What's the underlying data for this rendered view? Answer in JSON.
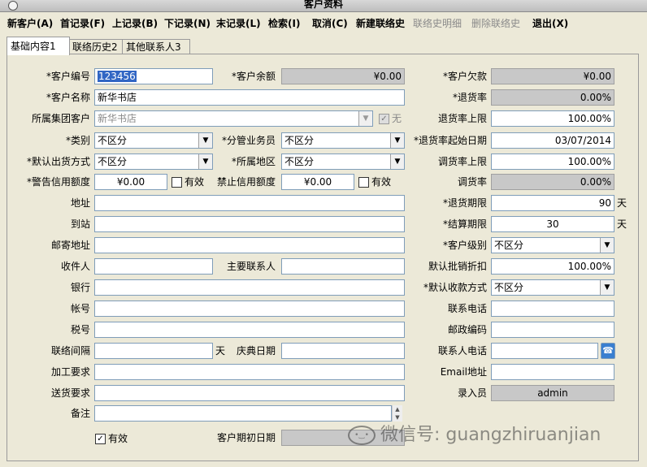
{
  "window": {
    "title": "客户资料"
  },
  "toolbar": {
    "items": [
      {
        "label": "新客户(A)",
        "enabled": true
      },
      {
        "label": "首记录(F)",
        "enabled": true
      },
      {
        "label": "上记录(B)",
        "enabled": true
      },
      {
        "label": "下记录(N)",
        "enabled": true
      },
      {
        "label": "末记录(L)",
        "enabled": true
      },
      {
        "label": "检索(I)",
        "enabled": true
      },
      {
        "label": "取消(C)",
        "enabled": true
      },
      {
        "label": "新建联络史",
        "enabled": true
      },
      {
        "label": "联络史明细",
        "enabled": false
      },
      {
        "label": "删除联络史",
        "enabled": false
      },
      {
        "label": "退出(X)",
        "enabled": true
      }
    ]
  },
  "tabs": [
    {
      "label": "基础内容1",
      "active": true
    },
    {
      "label": "联络历史2",
      "active": false
    },
    {
      "label": "其他联系人3",
      "active": false
    }
  ],
  "form": {
    "customer_id": {
      "label": "*客户编号",
      "value": "123456"
    },
    "balance": {
      "label": "*客户余额",
      "value": "¥0.00"
    },
    "debt": {
      "label": "*客户欠款",
      "value": "¥0.00"
    },
    "customer_name": {
      "label": "*客户名称",
      "value": "新华书店"
    },
    "return_rate": {
      "label": "*退货率",
      "value": "0.00%"
    },
    "group_customer": {
      "label": "所属集团客户",
      "value": "新华书店",
      "checkbox_label": "无"
    },
    "return_rate_limit": {
      "label": "退货率上限",
      "value": "100.00%"
    },
    "category": {
      "label": "*类别",
      "value": "不区分"
    },
    "salesman": {
      "label": "*分管业务员",
      "value": "不区分"
    },
    "return_rate_start": {
      "label": "*退货率起始日期",
      "value": "03/07/2014"
    },
    "default_ship": {
      "label": "*默认出货方式",
      "value": "不区分"
    },
    "region": {
      "label": "*所属地区",
      "value": "不区分"
    },
    "transfer_limit": {
      "label": "调货率上限",
      "value": "100.00%"
    },
    "warn_credit": {
      "label": "*警告信用额度",
      "value": "¥0.00",
      "check_label": "有效"
    },
    "ban_credit": {
      "label": "禁止信用额度",
      "value": "¥0.00",
      "check_label": "有效"
    },
    "transfer_rate": {
      "label": "调货率",
      "value": "0.00%"
    },
    "address": {
      "label": "地址",
      "value": ""
    },
    "return_period": {
      "label": "*退货期限",
      "value": "90",
      "unit": "天"
    },
    "station": {
      "label": "到站",
      "value": ""
    },
    "settle_period": {
      "label": "*结算期限",
      "value": "30",
      "unit": "天"
    },
    "mail_address": {
      "label": "邮寄地址",
      "value": ""
    },
    "customer_level": {
      "label": "*客户级别",
      "value": "不区分"
    },
    "receiver": {
      "label": "收件人",
      "value": ""
    },
    "main_contact": {
      "label": "主要联系人",
      "value": ""
    },
    "default_discount": {
      "label": "默认批销折扣",
      "value": "100.00%"
    },
    "bank": {
      "label": "银行",
      "value": ""
    },
    "default_payment": {
      "label": "*默认收款方式",
      "value": "不区分"
    },
    "account": {
      "label": "帐号",
      "value": ""
    },
    "contact_phone": {
      "label": "联系电话",
      "value": ""
    },
    "tax_no": {
      "label": "税号",
      "value": ""
    },
    "postcode": {
      "label": "邮政编码",
      "value": ""
    },
    "contact_interval": {
      "label": "联络间隔",
      "value": "",
      "unit": "天"
    },
    "anniversary": {
      "label": "庆典日期",
      "value": ""
    },
    "contact_person_phone": {
      "label": "联系人电话",
      "value": ""
    },
    "process_req": {
      "label": "加工要求",
      "value": ""
    },
    "email": {
      "label": "Email地址",
      "value": ""
    },
    "delivery_req": {
      "label": "送货要求",
      "value": ""
    },
    "entered_by": {
      "label": "录入员",
      "value": "admin"
    },
    "remark": {
      "label": "备注",
      "value": ""
    },
    "valid": {
      "label": "有效",
      "checked": true
    },
    "init_date": {
      "label": "客户期初日期",
      "value": ""
    }
  },
  "watermark": {
    "text": "微信号: guangzhiruanjian"
  }
}
